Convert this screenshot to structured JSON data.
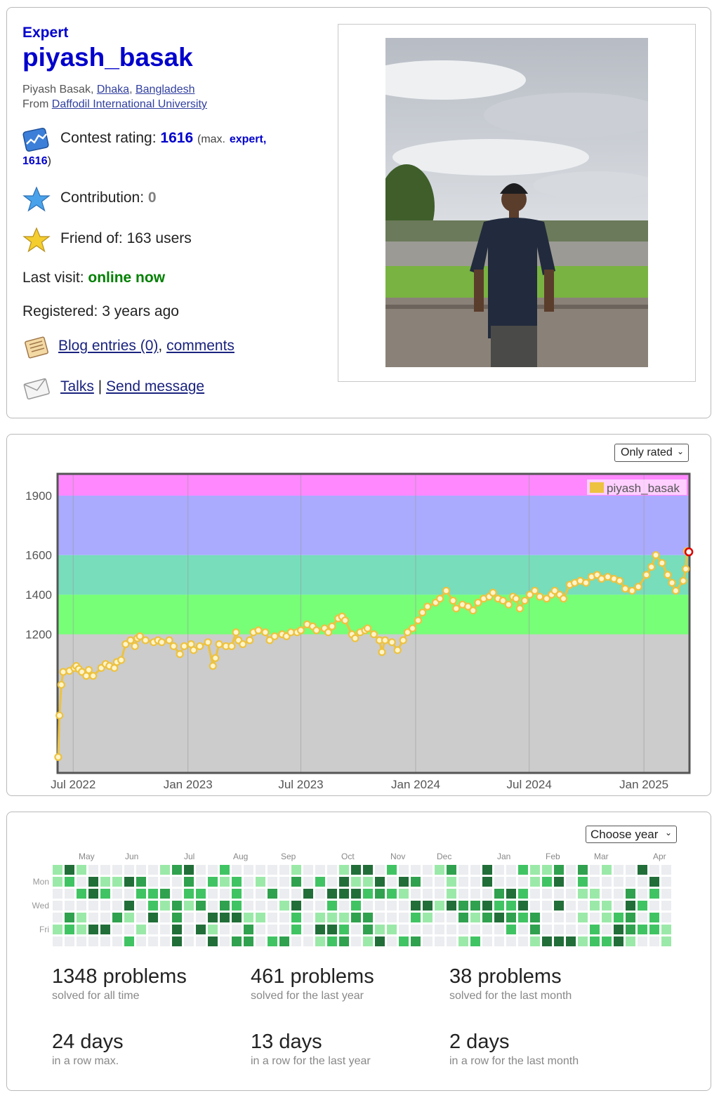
{
  "profile": {
    "rank": "Expert",
    "handle": "piyash_basak",
    "full_name": "Piyash Basak",
    "city": "Dhaka",
    "country": "Bangladesh",
    "from_label": "From",
    "organization": "Daffodil International University",
    "contest_rating_label": "Contest rating:",
    "contest_rating": "1616",
    "max_prefix": "(max.",
    "max_rank": "expert,",
    "max_rating": "1616",
    "max_suffix": ")",
    "contribution_label": "Contribution:",
    "contribution": "0",
    "friend_label": "Friend of:",
    "friend_value": "163 users",
    "last_visit_label": "Last visit:",
    "last_visit": "online now",
    "registered_label": "Registered:",
    "registered": "3 years ago",
    "blog_link": "Blog entries (0)",
    "comments_link": "comments",
    "talks_link": "Talks",
    "separator": "|",
    "send_message_link": "Send message",
    "colors": {
      "rank": "#0000cc",
      "online": "#008000",
      "link": "#1a237e"
    },
    "icons": [
      "rating-chart-icon",
      "star-blue-icon",
      "star-gold-icon",
      "blog-icon",
      "mail-icon"
    ]
  },
  "graph": {
    "filter_label": "Only rated",
    "chart_data": {
      "type": "line",
      "legend": "piyash_basak",
      "legend_position": "top-right",
      "y_ticks": [
        1200,
        1400,
        1600,
        1900
      ],
      "x_ticks": [
        "Jul 2022",
        "Jan 2023",
        "Jul 2023",
        "Jan 2024",
        "Jul 2024",
        "Jan 2025"
      ],
      "ylim": [
        500,
        2010
      ],
      "rank_bands": [
        {
          "from": 500,
          "to": 1200,
          "color": "#cccccc"
        },
        {
          "from": 1200,
          "to": 1400,
          "color": "#77ff77"
        },
        {
          "from": 1400,
          "to": 1600,
          "color": "#77ddbb"
        },
        {
          "from": 1600,
          "to": 1900,
          "color": "#aaaaff"
        },
        {
          "from": 1900,
          "to": 2010,
          "color": "#ff88ff"
        }
      ],
      "line_color": "#edc240",
      "series": [
        {
          "name": "piyash_basak",
          "points": [
            [
              "2022-06-07",
              580
            ],
            [
              "2022-06-09",
              790
            ],
            [
              "2022-06-12",
              945
            ],
            [
              "2022-06-15",
              1010
            ],
            [
              "2022-06-25",
              1015
            ],
            [
              "2022-07-03",
              1030
            ],
            [
              "2022-07-06",
              1040
            ],
            [
              "2022-07-10",
              1025
            ],
            [
              "2022-07-15",
              1010
            ],
            [
              "2022-07-22",
              990
            ],
            [
              "2022-07-26",
              1020
            ],
            [
              "2022-08-02",
              990
            ],
            [
              "2022-08-15",
              1030
            ],
            [
              "2022-08-22",
              1050
            ],
            [
              "2022-08-28",
              1040
            ],
            [
              "2022-09-05",
              1030
            ],
            [
              "2022-09-09",
              1060
            ],
            [
              "2022-09-16",
              1070
            ],
            [
              "2022-09-23",
              1150
            ],
            [
              "2022-10-01",
              1170
            ],
            [
              "2022-10-08",
              1140
            ],
            [
              "2022-10-12",
              1180
            ],
            [
              "2022-10-16",
              1190
            ],
            [
              "2022-10-25",
              1170
            ],
            [
              "2022-11-07",
              1160
            ],
            [
              "2022-11-14",
              1170
            ],
            [
              "2022-11-20",
              1160
            ],
            [
              "2022-12-02",
              1170
            ],
            [
              "2022-12-09",
              1140
            ],
            [
              "2022-12-19",
              1100
            ],
            [
              "2022-12-26",
              1140
            ],
            [
              "2023-01-06",
              1150
            ],
            [
              "2023-01-10",
              1120
            ],
            [
              "2023-01-20",
              1140
            ],
            [
              "2023-02-02",
              1160
            ],
            [
              "2023-02-10",
              1040
            ],
            [
              "2023-02-14",
              1080
            ],
            [
              "2023-02-20",
              1150
            ],
            [
              "2023-03-03",
              1140
            ],
            [
              "2023-03-12",
              1140
            ],
            [
              "2023-03-19",
              1210
            ],
            [
              "2023-03-23",
              1170
            ],
            [
              "2023-03-30",
              1150
            ],
            [
              "2023-04-10",
              1170
            ],
            [
              "2023-04-16",
              1210
            ],
            [
              "2023-04-24",
              1220
            ],
            [
              "2023-05-05",
              1210
            ],
            [
              "2023-05-12",
              1170
            ],
            [
              "2023-05-20",
              1190
            ],
            [
              "2023-06-01",
              1200
            ],
            [
              "2023-06-08",
              1190
            ],
            [
              "2023-06-15",
              1210
            ],
            [
              "2023-06-25",
              1210
            ],
            [
              "2023-07-01",
              1220
            ],
            [
              "2023-07-11",
              1250
            ],
            [
              "2023-07-20",
              1240
            ],
            [
              "2023-07-26",
              1220
            ],
            [
              "2023-08-08",
              1230
            ],
            [
              "2023-08-14",
              1210
            ],
            [
              "2023-08-20",
              1240
            ],
            [
              "2023-08-30",
              1280
            ],
            [
              "2023-09-05",
              1290
            ],
            [
              "2023-09-10",
              1270
            ],
            [
              "2023-09-21",
              1200
            ],
            [
              "2023-09-26",
              1180
            ],
            [
              "2023-10-04",
              1210
            ],
            [
              "2023-10-12",
              1220
            ],
            [
              "2023-10-16",
              1230
            ],
            [
              "2023-10-26",
              1200
            ],
            [
              "2023-11-04",
              1170
            ],
            [
              "2023-11-08",
              1110
            ],
            [
              "2023-11-13",
              1170
            ],
            [
              "2023-11-24",
              1160
            ],
            [
              "2023-12-03",
              1120
            ],
            [
              "2023-12-12",
              1170
            ],
            [
              "2023-12-19",
              1210
            ],
            [
              "2023-12-27",
              1230
            ],
            [
              "2024-01-05",
              1270
            ],
            [
              "2024-01-12",
              1310
            ],
            [
              "2024-01-20",
              1340
            ],
            [
              "2024-02-02",
              1360
            ],
            [
              "2024-02-09",
              1380
            ],
            [
              "2024-02-19",
              1420
            ],
            [
              "2024-03-01",
              1370
            ],
            [
              "2024-03-06",
              1330
            ],
            [
              "2024-03-16",
              1350
            ],
            [
              "2024-03-25",
              1340
            ],
            [
              "2024-04-02",
              1320
            ],
            [
              "2024-04-10",
              1360
            ],
            [
              "2024-04-19",
              1380
            ],
            [
              "2024-04-28",
              1390
            ],
            [
              "2024-05-04",
              1410
            ],
            [
              "2024-05-12",
              1380
            ],
            [
              "2024-05-20",
              1370
            ],
            [
              "2024-05-29",
              1350
            ],
            [
              "2024-06-05",
              1390
            ],
            [
              "2024-06-10",
              1380
            ],
            [
              "2024-06-16",
              1330
            ],
            [
              "2024-06-24",
              1370
            ],
            [
              "2024-07-02",
              1400
            ],
            [
              "2024-07-10",
              1420
            ],
            [
              "2024-07-18",
              1390
            ],
            [
              "2024-07-29",
              1380
            ],
            [
              "2024-08-06",
              1400
            ],
            [
              "2024-08-11",
              1420
            ],
            [
              "2024-08-19",
              1400
            ],
            [
              "2024-08-25",
              1380
            ],
            [
              "2024-09-04",
              1450
            ],
            [
              "2024-09-12",
              1460
            ],
            [
              "2024-09-21",
              1470
            ],
            [
              "2024-09-30",
              1460
            ],
            [
              "2024-10-09",
              1490
            ],
            [
              "2024-10-18",
              1500
            ],
            [
              "2024-10-25",
              1480
            ],
            [
              "2024-11-04",
              1490
            ],
            [
              "2024-11-14",
              1480
            ],
            [
              "2024-11-23",
              1470
            ],
            [
              "2024-12-02",
              1430
            ],
            [
              "2024-12-13",
              1420
            ],
            [
              "2024-12-23",
              1440
            ],
            [
              "2025-01-05",
              1500
            ],
            [
              "2025-01-13",
              1540
            ],
            [
              "2025-01-20",
              1600
            ],
            [
              "2025-01-30",
              1560
            ],
            [
              "2025-02-08",
              1500
            ],
            [
              "2025-02-15",
              1460
            ],
            [
              "2025-02-21",
              1420
            ],
            [
              "2025-03-05",
              1470
            ],
            [
              "2025-03-09",
              1530
            ],
            [
              "2025-03-11",
              1620
            ],
            [
              "2025-03-14",
              1616
            ]
          ]
        }
      ]
    }
  },
  "activity": {
    "choose_year_label": "Choose year",
    "months": [
      "May",
      "Jun",
      "Jul",
      "Aug",
      "Sep",
      "Oct",
      "Nov",
      "Dec",
      "Jan",
      "Feb",
      "Mar",
      "Apr"
    ],
    "day_labels": [
      "Mon",
      "Wed",
      "Fri"
    ],
    "legend_colors": [
      "#ebedf0",
      "#9be9a8",
      "#40c463",
      "#30a14e",
      "#216e39"
    ],
    "weeks": 52,
    "stats": [
      {
        "big": "1348 problems",
        "small": "solved for all time"
      },
      {
        "big": "461 problems",
        "small": "solved for the last year"
      },
      {
        "big": "38 problems",
        "small": "solved for the last month"
      },
      {
        "big": "24 days",
        "small": "in a row max."
      },
      {
        "big": "13 days",
        "small": "in a row for the last year"
      },
      {
        "big": "2 days",
        "small": "in a row for the last month"
      }
    ]
  }
}
